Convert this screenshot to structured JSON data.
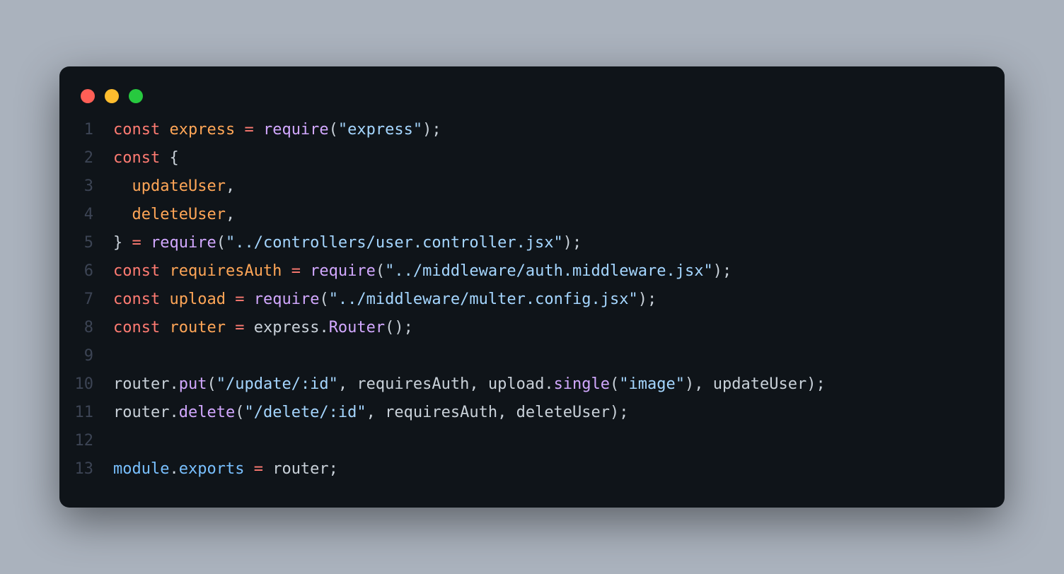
{
  "window": {
    "traffic_lights": {
      "red": "#ff5f56",
      "yellow": "#ffbd2e",
      "green": "#27c93f"
    }
  },
  "code": {
    "line_numbers": [
      "1",
      "2",
      "3",
      "4",
      "5",
      "6",
      "7",
      "8",
      "9",
      "10",
      "11",
      "12",
      "13"
    ],
    "lines": [
      [
        {
          "c": "kw",
          "t": "const"
        },
        {
          "c": "pn",
          "t": " "
        },
        {
          "c": "var",
          "t": "express"
        },
        {
          "c": "pn",
          "t": " "
        },
        {
          "c": "kw",
          "t": "="
        },
        {
          "c": "pn",
          "t": " "
        },
        {
          "c": "fn",
          "t": "require"
        },
        {
          "c": "pn",
          "t": "("
        },
        {
          "c": "str",
          "t": "\"express\""
        },
        {
          "c": "pn",
          "t": ");"
        }
      ],
      [
        {
          "c": "kw",
          "t": "const"
        },
        {
          "c": "pn",
          "t": " {"
        }
      ],
      [
        {
          "c": "pn",
          "t": "  "
        },
        {
          "c": "var",
          "t": "updateUser"
        },
        {
          "c": "pn",
          "t": ","
        }
      ],
      [
        {
          "c": "pn",
          "t": "  "
        },
        {
          "c": "var",
          "t": "deleteUser"
        },
        {
          "c": "pn",
          "t": ","
        }
      ],
      [
        {
          "c": "pn",
          "t": "} "
        },
        {
          "c": "kw",
          "t": "="
        },
        {
          "c": "pn",
          "t": " "
        },
        {
          "c": "fn",
          "t": "require"
        },
        {
          "c": "pn",
          "t": "("
        },
        {
          "c": "str",
          "t": "\"../controllers/user.controller.jsx\""
        },
        {
          "c": "pn",
          "t": ");"
        }
      ],
      [
        {
          "c": "kw",
          "t": "const"
        },
        {
          "c": "pn",
          "t": " "
        },
        {
          "c": "var",
          "t": "requiresAuth"
        },
        {
          "c": "pn",
          "t": " "
        },
        {
          "c": "kw",
          "t": "="
        },
        {
          "c": "pn",
          "t": " "
        },
        {
          "c": "fn",
          "t": "require"
        },
        {
          "c": "pn",
          "t": "("
        },
        {
          "c": "str",
          "t": "\"../middleware/auth.middleware.jsx\""
        },
        {
          "c": "pn",
          "t": ");"
        }
      ],
      [
        {
          "c": "kw",
          "t": "const"
        },
        {
          "c": "pn",
          "t": " "
        },
        {
          "c": "var",
          "t": "upload"
        },
        {
          "c": "pn",
          "t": " "
        },
        {
          "c": "kw",
          "t": "="
        },
        {
          "c": "pn",
          "t": " "
        },
        {
          "c": "fn",
          "t": "require"
        },
        {
          "c": "pn",
          "t": "("
        },
        {
          "c": "str",
          "t": "\"../middleware/multer.config.jsx\""
        },
        {
          "c": "pn",
          "t": ");"
        }
      ],
      [
        {
          "c": "kw",
          "t": "const"
        },
        {
          "c": "pn",
          "t": " "
        },
        {
          "c": "var",
          "t": "router"
        },
        {
          "c": "pn",
          "t": " "
        },
        {
          "c": "kw",
          "t": "="
        },
        {
          "c": "pn",
          "t": " "
        },
        {
          "c": "id",
          "t": "express"
        },
        {
          "c": "pn",
          "t": "."
        },
        {
          "c": "fn",
          "t": "Router"
        },
        {
          "c": "pn",
          "t": "();"
        }
      ],
      [
        {
          "c": "pn",
          "t": ""
        }
      ],
      [
        {
          "c": "id",
          "t": "router"
        },
        {
          "c": "pn",
          "t": "."
        },
        {
          "c": "fn",
          "t": "put"
        },
        {
          "c": "pn",
          "t": "("
        },
        {
          "c": "str",
          "t": "\"/update/:id\""
        },
        {
          "c": "pn",
          "t": ", requiresAuth, upload."
        },
        {
          "c": "fn",
          "t": "single"
        },
        {
          "c": "pn",
          "t": "("
        },
        {
          "c": "str",
          "t": "\"image\""
        },
        {
          "c": "pn",
          "t": "), updateUser);"
        }
      ],
      [
        {
          "c": "id",
          "t": "router"
        },
        {
          "c": "pn",
          "t": "."
        },
        {
          "c": "fn",
          "t": "delete"
        },
        {
          "c": "pn",
          "t": "("
        },
        {
          "c": "str",
          "t": "\"/delete/:id\""
        },
        {
          "c": "pn",
          "t": ", requiresAuth, deleteUser);"
        }
      ],
      [
        {
          "c": "pn",
          "t": ""
        }
      ],
      [
        {
          "c": "prop",
          "t": "module"
        },
        {
          "c": "pn",
          "t": "."
        },
        {
          "c": "prop",
          "t": "exports"
        },
        {
          "c": "pn",
          "t": " "
        },
        {
          "c": "kw",
          "t": "="
        },
        {
          "c": "pn",
          "t": " router;"
        }
      ]
    ]
  }
}
